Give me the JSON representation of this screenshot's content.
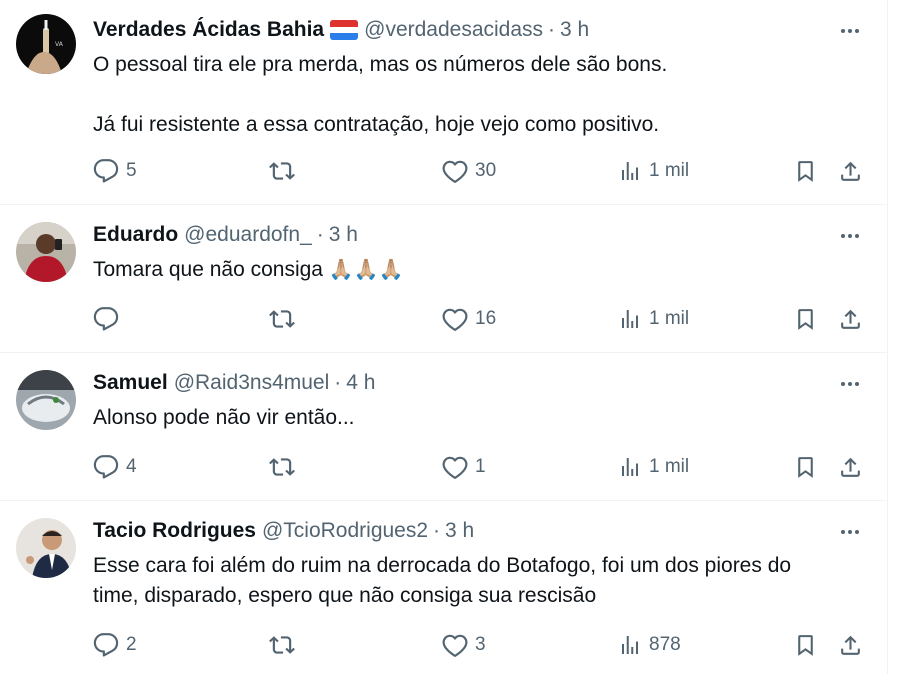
{
  "tweets": [
    {
      "name": "Verdades Ácidas Bahia",
      "handle": "@verdadesacidass",
      "sep": "·",
      "time": "3 h",
      "lines": [
        "O pessoal tira ele pra merda, mas os números dele são bons.",
        "",
        "Já fui resistente a essa contratação, hoje vejo como positivo."
      ],
      "replies": "5",
      "retweets": "",
      "likes": "30",
      "views": "1 mil",
      "flag_colors": [
        "#e03131",
        "#ffffff",
        "#2b7de9"
      ]
    },
    {
      "name": "Eduardo",
      "handle": "@eduardofn_",
      "sep": "·",
      "time": "3 h",
      "text": "Tomara que não consiga",
      "emoji": "🙏🏼🙏🏼🙏🏼",
      "replies": "",
      "retweets": "",
      "likes": "16",
      "views": "1 mil"
    },
    {
      "name": "Samuel",
      "handle": "@Raid3ns4muel",
      "sep": "·",
      "time": "4 h",
      "text": "Alonso pode não vir então...",
      "replies": "4",
      "retweets": "",
      "likes": "1",
      "views": "1 mil"
    },
    {
      "name": "Tacio Rodrigues",
      "handle": "@TcioRodrigues2",
      "sep": "·",
      "time": "3 h",
      "lines": [
        "Esse cara foi além do ruim na derrocada do Botafogo, foi um dos piores do",
        "time, disparado, espero que não consiga sua rescisão"
      ],
      "replies": "2",
      "retweets": "",
      "likes": "3",
      "views": "878"
    }
  ],
  "colors": {
    "text": "#0f1419",
    "secondary": "#536471",
    "border": "#eff3f4"
  },
  "icons": [
    "more-icon",
    "reply-icon",
    "retweet-icon",
    "like-icon",
    "views-icon",
    "bookmark-icon",
    "share-icon"
  ]
}
